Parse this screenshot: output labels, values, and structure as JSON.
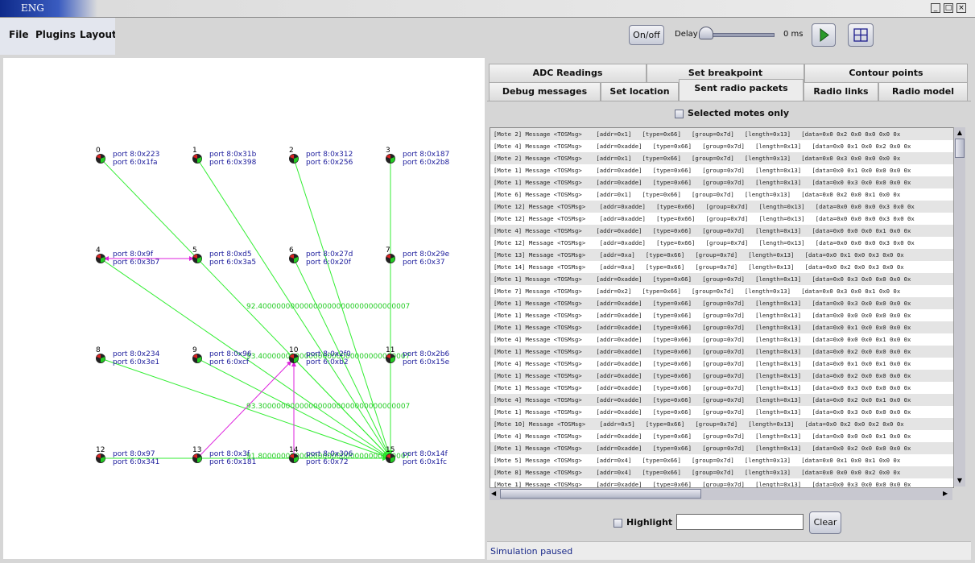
{
  "window": {
    "title": "ENG"
  },
  "menu": [
    "File",
    "Plugins",
    "Layout"
  ],
  "toolbar": {
    "onoff_label": "On/off",
    "delay_label": "Delay",
    "delay_value": "0 ms",
    "delay_fraction": 0.0
  },
  "tabs": {
    "row1": [
      "ADC Readings",
      "Set breakpoint",
      "Contour points"
    ],
    "row2": [
      "Debug messages",
      "Set location",
      "Sent radio packets",
      "Radio links",
      "Radio model"
    ],
    "active": "Sent radio packets"
  },
  "selected_motes_label": "Selected motes only",
  "log_rows": [
    "[Mote 2] Message <TOSMsg>    [addr=0x1]   [type=0x66]   [group=0x7d]   [length=0x13]   [data=0x0 0x2 0x0 0x0 0x0 0x",
    "[Mote 4] Message <TOSMsg>    [addr=0xadde]   [type=0x66]   [group=0x7d]   [length=0x13]   [data=0x0 0x1 0x0 0x2 0x0 0x",
    "[Mote 2] Message <TOSMsg>    [addr=0x1]   [type=0x66]   [group=0x7d]   [length=0x13]   [data=0x0 0x3 0x0 0x0 0x0 0x",
    "[Mote 1] Message <TOSMsg>    [addr=0xadde]   [type=0x66]   [group=0x7d]   [length=0x13]   [data=0x0 0x1 0x0 0x0 0x0 0x",
    "[Mote 1] Message <TOSMsg>    [addr=0xadde]   [type=0x66]   [group=0x7d]   [length=0x13]   [data=0x0 0x3 0x0 0x0 0x0 0x",
    "[Mote 6] Message <TOSMsg>    [addr=0x1]   [type=0x66]   [group=0x7d]   [length=0x13]   [data=0x0 0x2 0x0 0x1 0x0 0x",
    "[Mote 12] Message <TOSMsg>    [addr=0xadde]   [type=0x66]   [group=0x7d]   [length=0x13]   [data=0x0 0x0 0x0 0x3 0x0 0x",
    "[Mote 12] Message <TOSMsg>    [addr=0xadde]   [type=0x66]   [group=0x7d]   [length=0x13]   [data=0x0 0x0 0x0 0x3 0x0 0x",
    "[Mote 4] Message <TOSMsg>    [addr=0xadde]   [type=0x66]   [group=0x7d]   [length=0x13]   [data=0x0 0x0 0x0 0x1 0x0 0x",
    "[Mote 12] Message <TOSMsg>    [addr=0xadde]   [type=0x66]   [group=0x7d]   [length=0x13]   [data=0x0 0x0 0x0 0x3 0x0 0x",
    "[Mote 13] Message <TOSMsg>    [addr=0xa]   [type=0x66]   [group=0x7d]   [length=0x13]   [data=0x0 0x1 0x0 0x3 0x0 0x",
    "[Mote 14] Message <TOSMsg>    [addr=0xa]   [type=0x66]   [group=0x7d]   [length=0x13]   [data=0x0 0x2 0x0 0x3 0x0 0x",
    "[Mote 1] Message <TOSMsg>    [addr=0xadde]   [type=0x66]   [group=0x7d]   [length=0x13]   [data=0x0 0x3 0x0 0x0 0x0 0x",
    "[Mote 7] Message <TOSMsg>    [addr=0x2]   [type=0x66]   [group=0x7d]   [length=0x13]   [data=0x0 0x3 0x0 0x1 0x0 0x",
    "[Mote 1] Message <TOSMsg>    [addr=0xadde]   [type=0x66]   [group=0x7d]   [length=0x13]   [data=0x0 0x3 0x0 0x0 0x0 0x",
    "[Mote 1] Message <TOSMsg>    [addr=0xadde]   [type=0x66]   [group=0x7d]   [length=0x13]   [data=0x0 0x0 0x0 0x0 0x0 0x",
    "[Mote 1] Message <TOSMsg>    [addr=0xadde]   [type=0x66]   [group=0x7d]   [length=0x13]   [data=0x0 0x1 0x0 0x0 0x0 0x",
    "[Mote 4] Message <TOSMsg>    [addr=0xadde]   [type=0x66]   [group=0x7d]   [length=0x13]   [data=0x0 0x0 0x0 0x1 0x0 0x",
    "[Mote 1] Message <TOSMsg>    [addr=0xadde]   [type=0x66]   [group=0x7d]   [length=0x13]   [data=0x0 0x2 0x0 0x0 0x0 0x",
    "[Mote 4] Message <TOSMsg>    [addr=0xadde]   [type=0x66]   [group=0x7d]   [length=0x13]   [data=0x0 0x1 0x0 0x1 0x0 0x",
    "[Mote 1] Message <TOSMsg>    [addr=0xadde]   [type=0x66]   [group=0x7d]   [length=0x13]   [data=0x0 0x2 0x0 0x0 0x0 0x",
    "[Mote 1] Message <TOSMsg>    [addr=0xadde]   [type=0x66]   [group=0x7d]   [length=0x13]   [data=0x0 0x3 0x0 0x0 0x0 0x",
    "[Mote 4] Message <TOSMsg>    [addr=0xadde]   [type=0x66]   [group=0x7d]   [length=0x13]   [data=0x0 0x2 0x0 0x1 0x0 0x",
    "[Mote 1] Message <TOSMsg>    [addr=0xadde]   [type=0x66]   [group=0x7d]   [length=0x13]   [data=0x0 0x3 0x0 0x0 0x0 0x",
    "[Mote 10] Message <TOSMsg>    [addr=0x5]   [type=0x66]   [group=0x7d]   [length=0x13]   [data=0x0 0x2 0x0 0x2 0x0 0x",
    "[Mote 4] Message <TOSMsg>    [addr=0xadde]   [type=0x66]   [group=0x7d]   [length=0x13]   [data=0x0 0x0 0x0 0x1 0x0 0x",
    "[Mote 1] Message <TOSMsg>    [addr=0xadde]   [type=0x66]   [group=0x7d]   [length=0x13]   [data=0x0 0x2 0x0 0x0 0x0 0x",
    "[Mote 5] Message <TOSMsg>    [addr=0x4]   [type=0x66]   [group=0x7d]   [length=0x13]   [data=0x0 0x1 0x0 0x1 0x0 0x",
    "[Mote 8] Message <TOSMsg>    [addr=0x4]   [type=0x66]   [group=0x7d]   [length=0x13]   [data=0x0 0x0 0x0 0x2 0x0 0x",
    "[Mote 1] Message <TOSMsg>    [addr=0xadde]   [type=0x66]   [group=0x7d]   [length=0x13]   [data=0x0 0x3 0x0 0x0 0x0 0x",
    "[Mote 9] Message <TOSMsg>    [addr=0x4]   [type=0x66]   [group=0x7d]   [length=0x13]   [data=0x0 0x1 0x0 0x2 0x0 0x"
  ],
  "highlight_label": "Highlight",
  "highlight_value": "",
  "clear_label": "Clear",
  "status": "Simulation paused",
  "motes": [
    {
      "id": "0",
      "port8": "port 8:0x223",
      "port6": "port 6:0x1fa"
    },
    {
      "id": "1",
      "port8": "port 8:0x31b",
      "port6": "port 6:0x398"
    },
    {
      "id": "2",
      "port8": "port 8:0x312",
      "port6": "port 6:0x256"
    },
    {
      "id": "3",
      "port8": "port 8:0x187",
      "port6": "port 6:0x2b8"
    },
    {
      "id": "4",
      "port8": "port 8:0x9f",
      "port6": "port 6:0x3b7"
    },
    {
      "id": "5",
      "port8": "port 8:0xd5",
      "port6": "port 6:0x3a5"
    },
    {
      "id": "6",
      "port8": "port 8:0x27d",
      "port6": "port 6:0x20f"
    },
    {
      "id": "7",
      "port8": "port 8:0x29e",
      "port6": "port 6:0x37"
    },
    {
      "id": "8",
      "port8": "port 8:0x234",
      "port6": "port 6:0x3e1"
    },
    {
      "id": "9",
      "port8": "port 8:0x96",
      "port6": "port 6:0xcf"
    },
    {
      "id": "10",
      "port8": "port 8:0x2f0",
      "port6": "port 6:0xb2"
    },
    {
      "id": "11",
      "port8": "port 8:0x2b6",
      "port6": "port 6:0x15e"
    },
    {
      "id": "12",
      "port8": "port 8:0x97",
      "port6": "port 6:0x341"
    },
    {
      "id": "13",
      "port8": "port 8:0x3f",
      "port6": "port 6:0x181"
    },
    {
      "id": "14",
      "port8": "port 8:0x306",
      "port6": "port 6:0x72"
    },
    {
      "id": "15",
      "port8": "port 8:0x14f",
      "port6": "port 6:0x1fc"
    }
  ],
  "green_links_to_15": [
    "0",
    "1",
    "2",
    "3",
    "4",
    "6",
    "7",
    "8",
    "9",
    "10",
    "11",
    "12",
    "13",
    "14"
  ],
  "magenta_links": [
    [
      "5",
      "4"
    ],
    [
      "13",
      "10"
    ],
    [
      "14",
      "10"
    ]
  ],
  "edge_labels": [
    "92.400000000000000000000000000000007",
    "93.400000000000000000000000000000007",
    "93.300000000000000000000000000000007",
    "91.800000000000000000000000000000007"
  ],
  "colors": {
    "green_link": "#33ee33",
    "magenta_link": "#dd22dd",
    "accent": "#1c1c9c"
  }
}
